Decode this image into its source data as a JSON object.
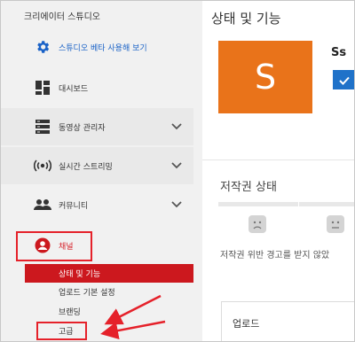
{
  "sidebar": {
    "title": "크리에이터 스튜디오",
    "items": [
      {
        "label": "스튜디오 베타 사용해 보기"
      },
      {
        "label": "대시보드"
      },
      {
        "label": "동영상 관리자"
      },
      {
        "label": "실시간 스트리밍"
      },
      {
        "label": "커뮤니티"
      },
      {
        "label": "채널"
      }
    ],
    "channel_sub": [
      {
        "label": "상태 및 기능"
      },
      {
        "label": "업로드 기본 설정"
      },
      {
        "label": "브랜딩"
      },
      {
        "label": "고급"
      }
    ]
  },
  "main": {
    "title": "상태 및 기능",
    "avatar_letter": "S",
    "channel_name": "Ss",
    "copyright_title": "저작권 상태",
    "copyright_text": "저작권 위반 경고를 받지 않았",
    "upload_label": "업로드"
  },
  "colors": {
    "accent_blue": "#1a62c7",
    "active_red": "#cc181e",
    "highlight_red": "#e5212a",
    "avatar_orange": "#e9731a"
  }
}
